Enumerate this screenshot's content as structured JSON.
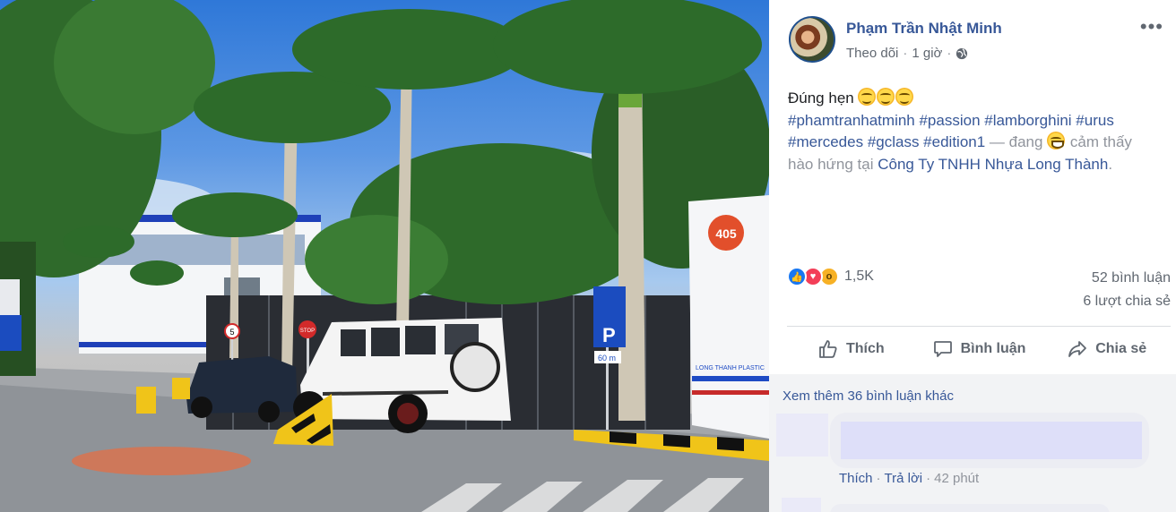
{
  "post": {
    "author": "Phạm Trần Nhật Minh",
    "follow_label": "Theo dõi",
    "separator": "·",
    "time": "1 giờ",
    "audience_icon": "globe-icon",
    "more_options_label": "•••",
    "text": {
      "line1": "Đúng hẹn",
      "hashtags_line1": "#phamtranhatminh #passion #lamborghini #urus",
      "hashtags_line2": "#mercedes #gclass #edition1",
      "feeling_prefix": " — đang",
      "feeling": "cảm thấy",
      "feeling_line2": "hào hứng tại",
      "place": "Công Ty TNHH Nhựa Long Thành",
      "period": "."
    }
  },
  "stats": {
    "reactions": [
      "like",
      "love",
      "wow"
    ],
    "reaction_count": "1,5K",
    "comments": "52 bình luận",
    "shares": "6 lượt chia sẻ"
  },
  "actions": {
    "like": "Thích",
    "comment": "Bình luận",
    "share": "Chia sẻ"
  },
  "comments": {
    "view_more": "Xem thêm 36 bình luận khác",
    "first": {
      "like": "Thích",
      "reply": "Trả lời",
      "time": "42 phút"
    }
  },
  "photo": {
    "sign_number": "405",
    "stop_sign": "STOP",
    "parking_letter": "P",
    "distance_sign": "60 m",
    "speed_sign": "5",
    "wall_brand": "LONG THANH PLASTIC"
  },
  "colors": {
    "link": "#385898",
    "secondary_text": "#606770",
    "divider": "#dadde1",
    "comment_bg": "#f2f3f5"
  }
}
